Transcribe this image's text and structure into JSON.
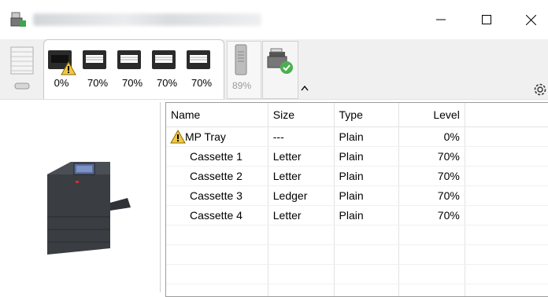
{
  "window": {
    "minimize_icon": "minimize-icon",
    "maximize_icon": "maximize-icon",
    "close_icon": "close-icon"
  },
  "toolbar": {
    "trays": [
      {
        "percent": "0%",
        "warning": true
      },
      {
        "percent": "70%"
      },
      {
        "percent": "70%"
      },
      {
        "percent": "70%"
      },
      {
        "percent": "70%"
      }
    ],
    "toner_percent": "89%",
    "settings_icon": "gear-icon"
  },
  "table": {
    "headers": {
      "name": "Name",
      "size": "Size",
      "type": "Type",
      "level": "Level"
    },
    "rows": [
      {
        "name": "MP Tray",
        "size": "---",
        "type": "Plain",
        "level": "0%",
        "warning": true
      },
      {
        "name": "Cassette 1",
        "size": "Letter",
        "type": "Plain",
        "level": "70%"
      },
      {
        "name": "Cassette 2",
        "size": "Letter",
        "type": "Plain",
        "level": "70%"
      },
      {
        "name": "Cassette 3",
        "size": "Ledger",
        "type": "Plain",
        "level": "70%"
      },
      {
        "name": "Cassette 4",
        "size": "Letter",
        "type": "Plain",
        "level": "70%"
      }
    ]
  },
  "colors": {
    "warning": "#f2c744",
    "check": "#4caf50",
    "printer_body": "#3a3d42"
  }
}
